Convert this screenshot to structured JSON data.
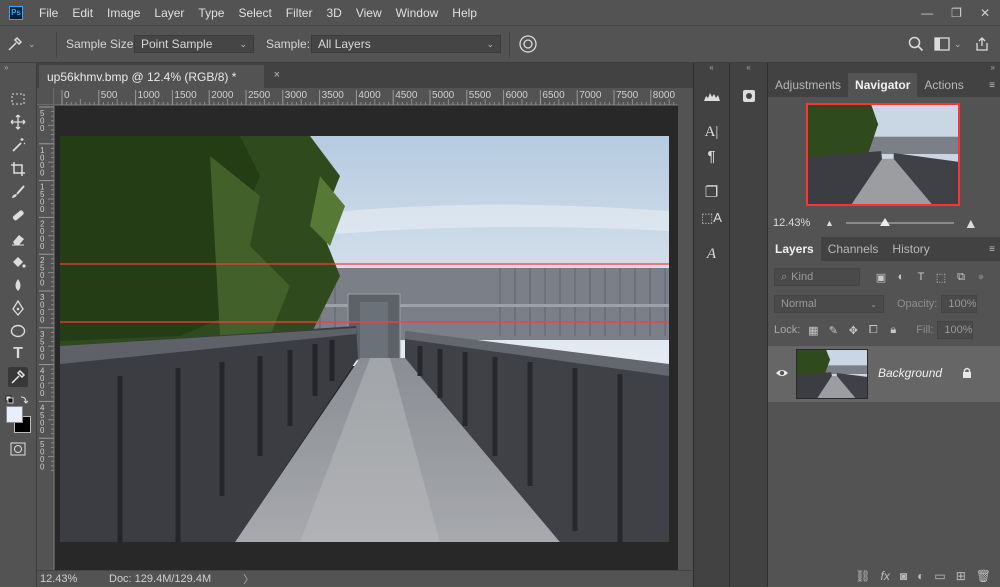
{
  "menubar": {
    "logo": "Ps",
    "items": [
      "File",
      "Edit",
      "Image",
      "Layer",
      "Type",
      "Select",
      "Filter",
      "3D",
      "View",
      "Window",
      "Help"
    ],
    "window_controls": [
      "—",
      "❐",
      "✕"
    ]
  },
  "options": {
    "sample_size_label": "Sample Size:",
    "sample_size_value": "Point Sample",
    "sample_label": "Sample:",
    "sample_value": "All Layers"
  },
  "document": {
    "tab_title": "up56khmv.bmp @ 12.4% (RGB/8) *",
    "close": "×"
  },
  "ruler": {
    "top_ticks": [
      "0",
      "500",
      "1000",
      "1500",
      "2000",
      "2500",
      "3000",
      "3500",
      "4000",
      "4500",
      "5000",
      "5500",
      "6000",
      "6500",
      "7000",
      "7500",
      "8000"
    ],
    "left_ticks": [
      "5\n0\n0",
      "1\n0\n0\n0",
      "1\n5\n0\n0",
      "2\n0\n0\n0",
      "2\n5\n0\n0",
      "3\n0\n0\n0",
      "3\n5\n0\n0",
      "4\n0\n0\n0",
      "4\n5\n0\n0",
      "5\n0\n0\n0"
    ]
  },
  "status": {
    "zoom": "12.43%",
    "doc": "Doc: 129.4M/129.4M",
    "arrow": "〉"
  },
  "panels": {
    "top_tabs": [
      "Adjustments",
      "Navigator",
      "Actions"
    ],
    "top_active": "Navigator",
    "navigator_zoom": "12.43%",
    "bottom_tabs": [
      "Layers",
      "Channels",
      "History"
    ],
    "bottom_active": "Layers",
    "kind_placeholder": "Kind",
    "blend_mode": "Normal",
    "opacity_label": "Opacity:",
    "opacity_value": "100%",
    "lock_label": "Lock:",
    "fill_label": "Fill:",
    "fill_value": "100%",
    "layer_name": "Background"
  },
  "colors": {
    "accent_guide": "#ff3b3b",
    "panel_bg": "#535353",
    "dark_bg": "#282828"
  }
}
